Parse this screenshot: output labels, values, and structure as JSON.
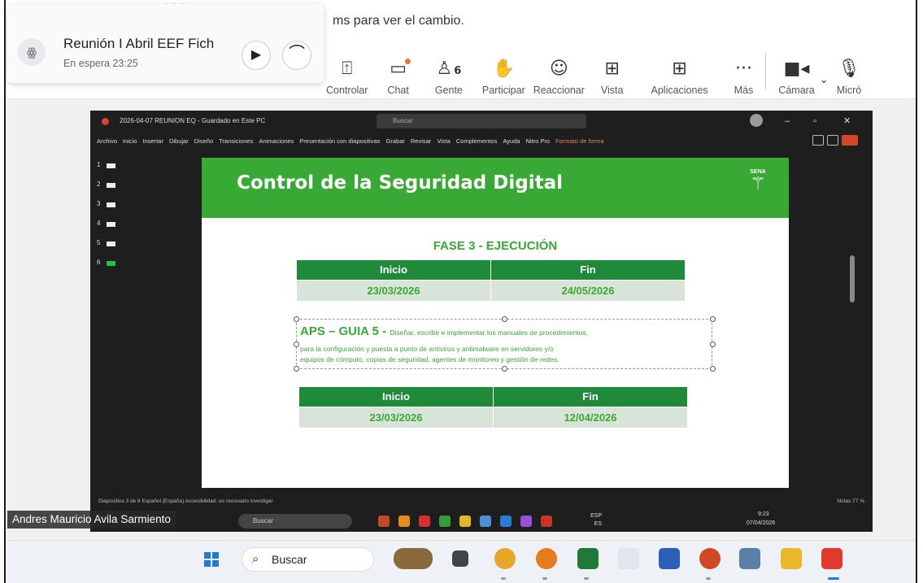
{
  "banner": {
    "text": "ms para ver el cambio."
  },
  "hold_card": {
    "title": "Reunión I Abril EEF Fich",
    "subtitle": "En espera  23:25",
    "resume_icon": "play-icon",
    "end_icon": "hang-up-icon"
  },
  "toolbar": [
    {
      "id": "controlar",
      "label": "Controlar",
      "icon": "screen-control-icon"
    },
    {
      "id": "chat",
      "label": "Chat",
      "icon": "chat-icon"
    },
    {
      "id": "gente",
      "label": "Gente",
      "icon": "people-icon",
      "count": "6"
    },
    {
      "id": "participar",
      "label": "Participar",
      "icon": "raise-hand-icon"
    },
    {
      "id": "reaccionar",
      "label": "Reaccionar",
      "icon": "smile-icon"
    },
    {
      "id": "vista",
      "label": "Vista",
      "icon": "grid-icon"
    },
    {
      "id": "aplicaciones",
      "label": "Aplicaciones",
      "icon": "add-app-icon"
    },
    {
      "id": "mas",
      "label": "Más",
      "icon": "more-icon"
    },
    {
      "id": "camara",
      "label": "Cámara",
      "icon": "camera-icon"
    },
    {
      "id": "micro",
      "label": "Micró",
      "icon": "mic-icon"
    }
  ],
  "ppt": {
    "filename": "2026-04-07 REUNION EQ - Guardado en Este PC",
    "search_placeholder": "Buscar",
    "ribbon": [
      "Archivo",
      "Inicio",
      "Insertar",
      "Dibujar",
      "Diseño",
      "Transiciones",
      "Animaciones",
      "Presentación con diapositivas",
      "Grabar",
      "Revisar",
      "Vista",
      "Complementos",
      "Ayuda",
      "Nitro Pro",
      "Formato de forma"
    ],
    "thumbs": [
      "1",
      "2",
      "3",
      "4",
      "5",
      "6"
    ],
    "status_left": "Diapositiva 3 de 6     Español (España)     Accesibilidad: es necesario investigar",
    "status_right": "Notas     77 %"
  },
  "slide": {
    "title": "Control de la Seguridad Digital",
    "logo_text": "SENA",
    "phase": "FASE 3 - EJECUCIÓN",
    "table1": {
      "headers": [
        "Inicio",
        "Fin"
      ],
      "values": [
        "23/03/2026",
        "24/05/2026"
      ]
    },
    "aps_title": "APS – GUIA 5 - ",
    "aps_desc1": "Diseñar, escribir e implementar los manuales de procedimientos,",
    "aps_desc2": "para la configuración y puesta a punto de antivirus y antimalware en servidores y/o",
    "aps_desc3": "equipos de cómputo, copias de seguridad, agentes de monitoreo y gestión de redes.",
    "table2": {
      "headers": [
        "Inicio",
        "Fin"
      ],
      "values": [
        "23/03/2026",
        "12/04/2026"
      ]
    }
  },
  "presenter": {
    "name": "Andres Mauricio Avila Sarmiento"
  },
  "inner_taskbar": {
    "search": "Buscar",
    "lang": "ESP ES",
    "time": "9:23",
    "date": "07/04/2026"
  },
  "taskbar": {
    "search": "Buscar"
  }
}
